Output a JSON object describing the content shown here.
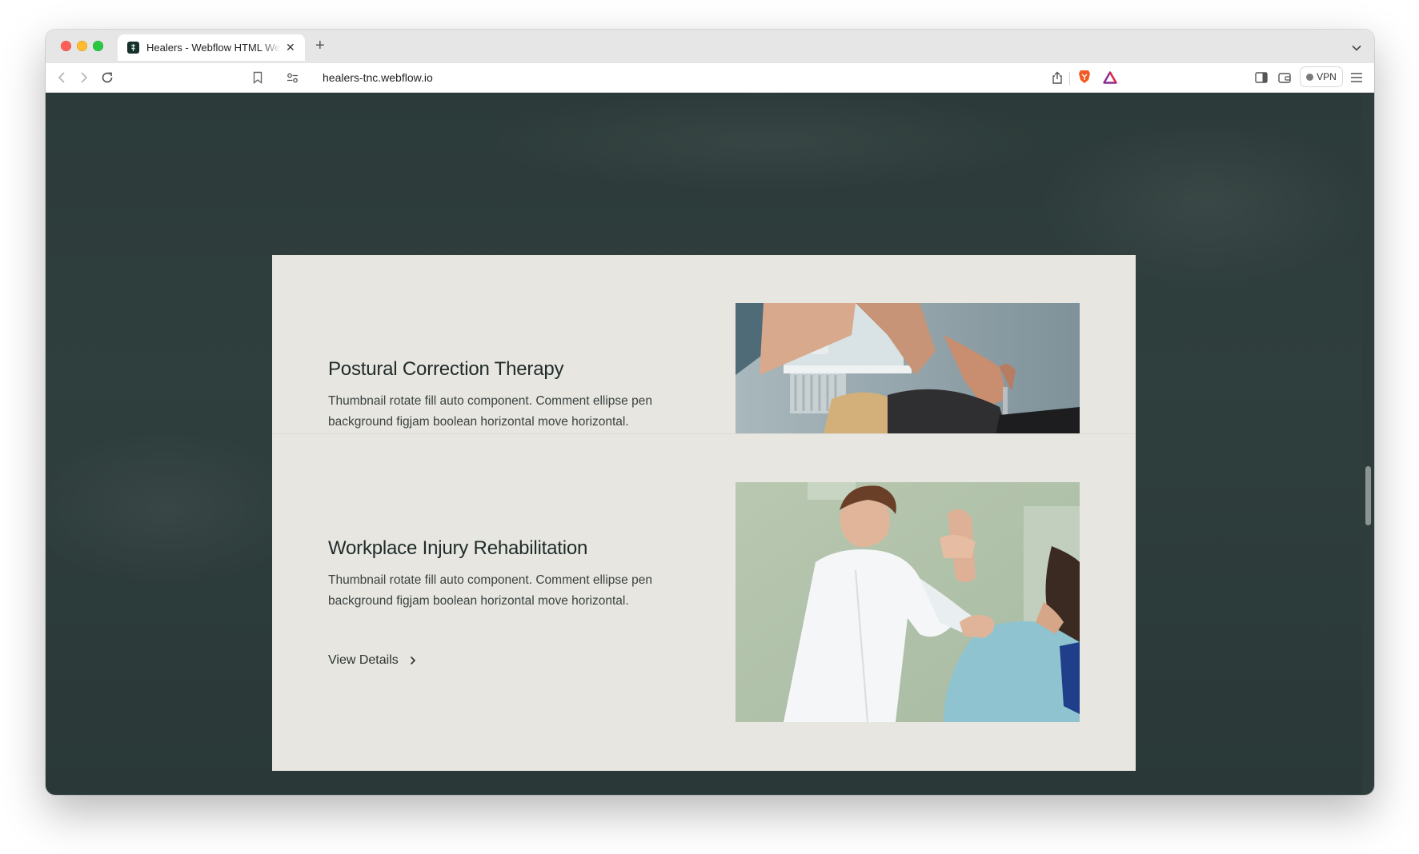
{
  "browser": {
    "tab_title": "Healers - Webflow HTML Website Template",
    "url": "healers-tnc.webflow.io",
    "vpn_label": "VPN"
  },
  "services": [
    {
      "title": "Postural Correction Therapy",
      "description": "Thumbnail rotate fill auto component. Comment ellipse pen background figjam boolean horizontal move horizontal."
    },
    {
      "title": "Workplace Injury Rehabilitation",
      "description": "Thumbnail rotate fill auto component. Comment ellipse pen background figjam boolean horizontal move horizontal.",
      "link_label": "View Details"
    }
  ],
  "colors": {
    "page_background": "#2c3b39",
    "card_background": "#e8e6e1",
    "heading": "#1e2b29"
  }
}
